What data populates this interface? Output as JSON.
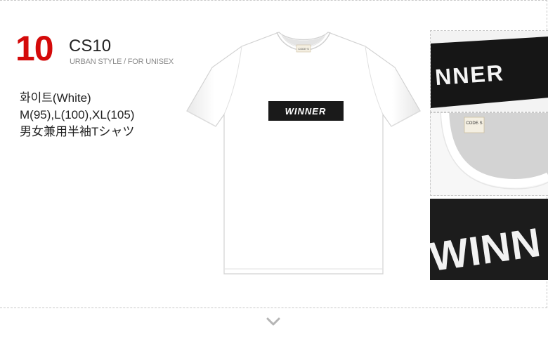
{
  "product": {
    "number": "10",
    "code": "CS10",
    "tagline": "URBAN STYLE / FOR UNISEX",
    "color_line": "화이트(White)",
    "size_line": "M(95),L(100),XL(105)",
    "desc_line": "男女兼用半袖Tシャツ"
  },
  "shirt": {
    "print_text": "WINNER",
    "tag_text": "CODE·S",
    "color": "#ffffff",
    "print_color": "#1a1a1a"
  },
  "thumbnails": {
    "detail1_text": "NNER",
    "detail2_tag": "CODE·S",
    "detail3_text": "WINN"
  },
  "accent_color": "#d40a0a",
  "icons": [
    "chevron-down-icon"
  ]
}
